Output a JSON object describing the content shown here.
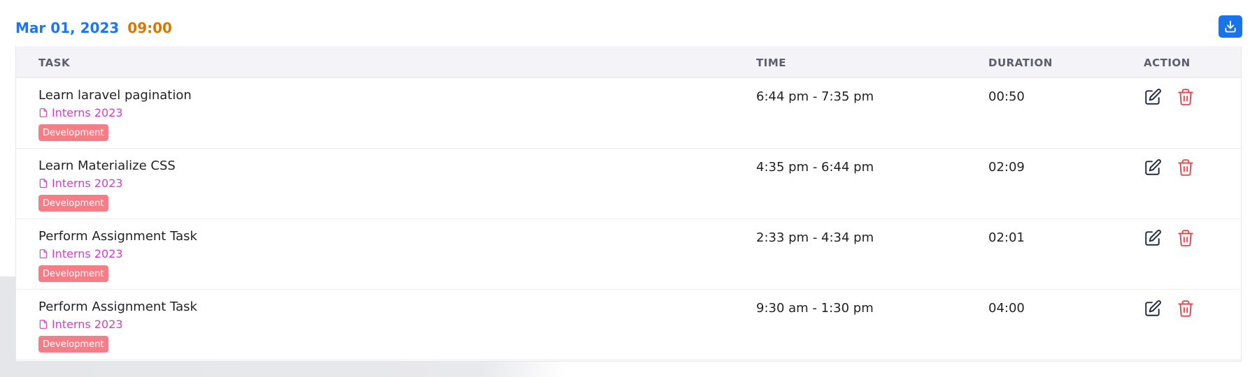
{
  "header": {
    "date": "Mar 01, 2023",
    "time": "09:00",
    "download_icon": "download-icon"
  },
  "colors": {
    "date": "#1e74f5",
    "time": "#d97706",
    "project": "#d63acd",
    "badge_bg": "#f67d86",
    "delete": "#e5484d",
    "edit": "#1f2a44",
    "download_bg": "#1a73e8"
  },
  "table": {
    "columns": [
      "TASK",
      "TIME",
      "DURATION",
      "ACTION"
    ],
    "rows": [
      {
        "task": "Learn laravel pagination",
        "project": "Interns 2023",
        "tag": "Development",
        "time": "6:44 pm - 7:35 pm",
        "duration": "00:50"
      },
      {
        "task": "Learn Materialize CSS",
        "project": "Interns 2023",
        "tag": "Development",
        "time": "4:35 pm - 6:44 pm",
        "duration": "02:09"
      },
      {
        "task": "Perform Assignment Task",
        "project": "Interns 2023",
        "tag": "Development",
        "time": "2:33 pm - 4:34 pm",
        "duration": "02:01"
      },
      {
        "task": "Perform Assignment Task",
        "project": "Interns 2023",
        "tag": "Development",
        "time": "9:30 am - 1:30 pm",
        "duration": "04:00"
      }
    ]
  },
  "icons": {
    "project": "file-icon",
    "edit": "edit-icon",
    "delete": "trash-icon"
  }
}
